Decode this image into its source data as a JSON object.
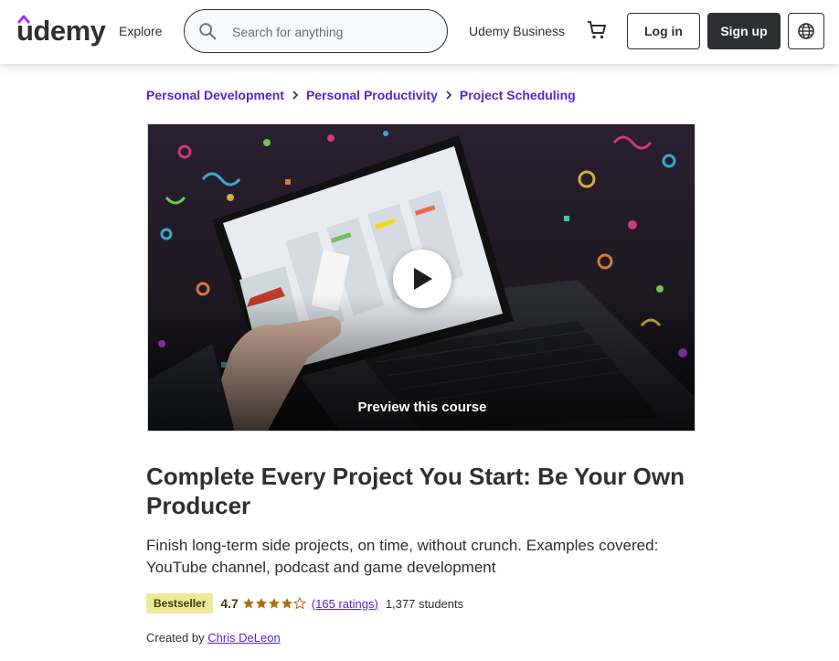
{
  "header": {
    "logo_text": "udemy",
    "explore_label": "Explore",
    "search": {
      "placeholder": "Search for anything",
      "value": ""
    },
    "business_label": "Udemy Business",
    "login_label": "Log in",
    "signup_label": "Sign up",
    "icons": {
      "search": "search-icon",
      "cart": "cart-icon",
      "language": "globe-icon"
    }
  },
  "breadcrumb": [
    {
      "label": "Personal Development"
    },
    {
      "label": "Personal Productivity"
    },
    {
      "label": "Project Scheduling"
    }
  ],
  "video": {
    "preview_label": "Preview this course"
  },
  "course": {
    "title": "Complete Every Project You Start: Be Your Own Producer",
    "subtitle": "Finish long-term side projects, on time, without crunch. Examples covered: YouTube channel, podcast and game development",
    "badge": "Bestseller",
    "rating": "4.7",
    "stars": 4.5,
    "ratings_count": "(165 ratings)",
    "students": "1,377 students",
    "created_by_label": "Created by",
    "author": "Chris DeLeon"
  },
  "colors": {
    "brand_purple": "#5624d0",
    "text_dark": "#2d2f31",
    "badge_bg": "#eceb98",
    "star": "#b4690e"
  }
}
